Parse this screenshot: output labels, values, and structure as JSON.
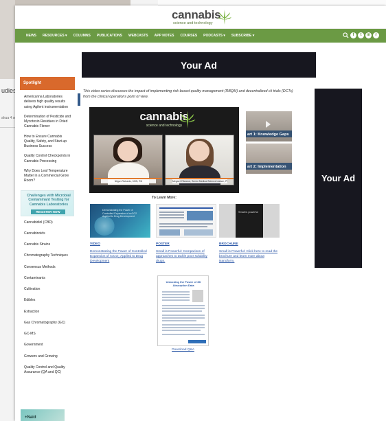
{
  "background": {
    "partial_text": "udies c",
    "tiny_text": "ahua 4 sumi"
  },
  "logo": {
    "word": "cannabis",
    "subtitle": "science and technology"
  },
  "nav": {
    "items": [
      "NEWS",
      "RESOURCES ▾",
      "COLUMNS",
      "PUBLICATIONS",
      "WEBCASTS",
      "APP NOTES",
      "COURSES",
      "PODCASTS ▾",
      "SUBSCRIBE ▾"
    ],
    "social_icons": [
      "facebook-icon",
      "twitter-icon",
      "linkedin-icon",
      "rss-icon"
    ]
  },
  "ads": {
    "top": "Your Ad",
    "right": "Your Ad"
  },
  "sidebar": {
    "spotlight_title": "Spotlight",
    "spotlight_items": [
      "Americanna Laboratories delivers high quality results using Agilent instrumentation",
      "Determination of Pesticide and Mycotoxin Residues in Dried Cannabis Flower",
      "How to Ensure Cannabis Quality, Safety, and Start-up Business Success",
      "Quality Control Checkpoints in Cannabis Processing",
      "Why Does Leaf Temperature Matter in a Commercial Grow Room?"
    ],
    "banner": {
      "title": "Challenges with Microbial Contaminant Testing for Cannabis Laboratories",
      "button": "REGISTER NOW"
    },
    "categories": [
      "Cannabidiol (CBD)",
      "Cannabinoids",
      "Cannabis Strains",
      "Chromatography Techniques",
      "Consensus Methods",
      "Contaminants",
      "Cultivation",
      "Edibles",
      "Extraction",
      "Gas Chromatography (GC)",
      "GC-MS",
      "Government",
      "Growers and Growing",
      "Quality Control and Quality Assurance (QA and QC)"
    ],
    "bottom_ad_text": "+Naid"
  },
  "main": {
    "intro": "This video series discusses the impact of implementing risk-based quality management (RBQM) and decentralized cli trials (DCTs) from the clinical operations point of view.",
    "video": {
      "left_name": "Nilgun Richards, MSN, RN",
      "right_name": "Megan O'Bannon, Senior Medical Science Liaison, Pharma"
    },
    "thumbnails": [
      "art 1: Knowledge Gaps",
      "art 2: Implementation"
    ],
    "to_learn_more": "To Learn More:",
    "cards": [
      {
        "type": "VIDEO",
        "image_text": "Demonstrating the Power of Controlled Expansion of scCO2 Applied to Drug Development",
        "link": "Demonstrating the Power of Controlled Expansion of scCO₂ Applied to Drug Development"
      },
      {
        "type": "POSTER",
        "link": "Small is Powerful: Comparison of approaches to tackle poor solubility drugs."
      },
      {
        "type": "BROCHURE",
        "image_text": "Small is powerful",
        "link": "Small is Powerful: Click here to read the brochure and learn more about Nanoform."
      }
    ],
    "qa": {
      "title": "Unlocking the Power of 3D Absorption Data",
      "link": "Download Q&A"
    }
  }
}
